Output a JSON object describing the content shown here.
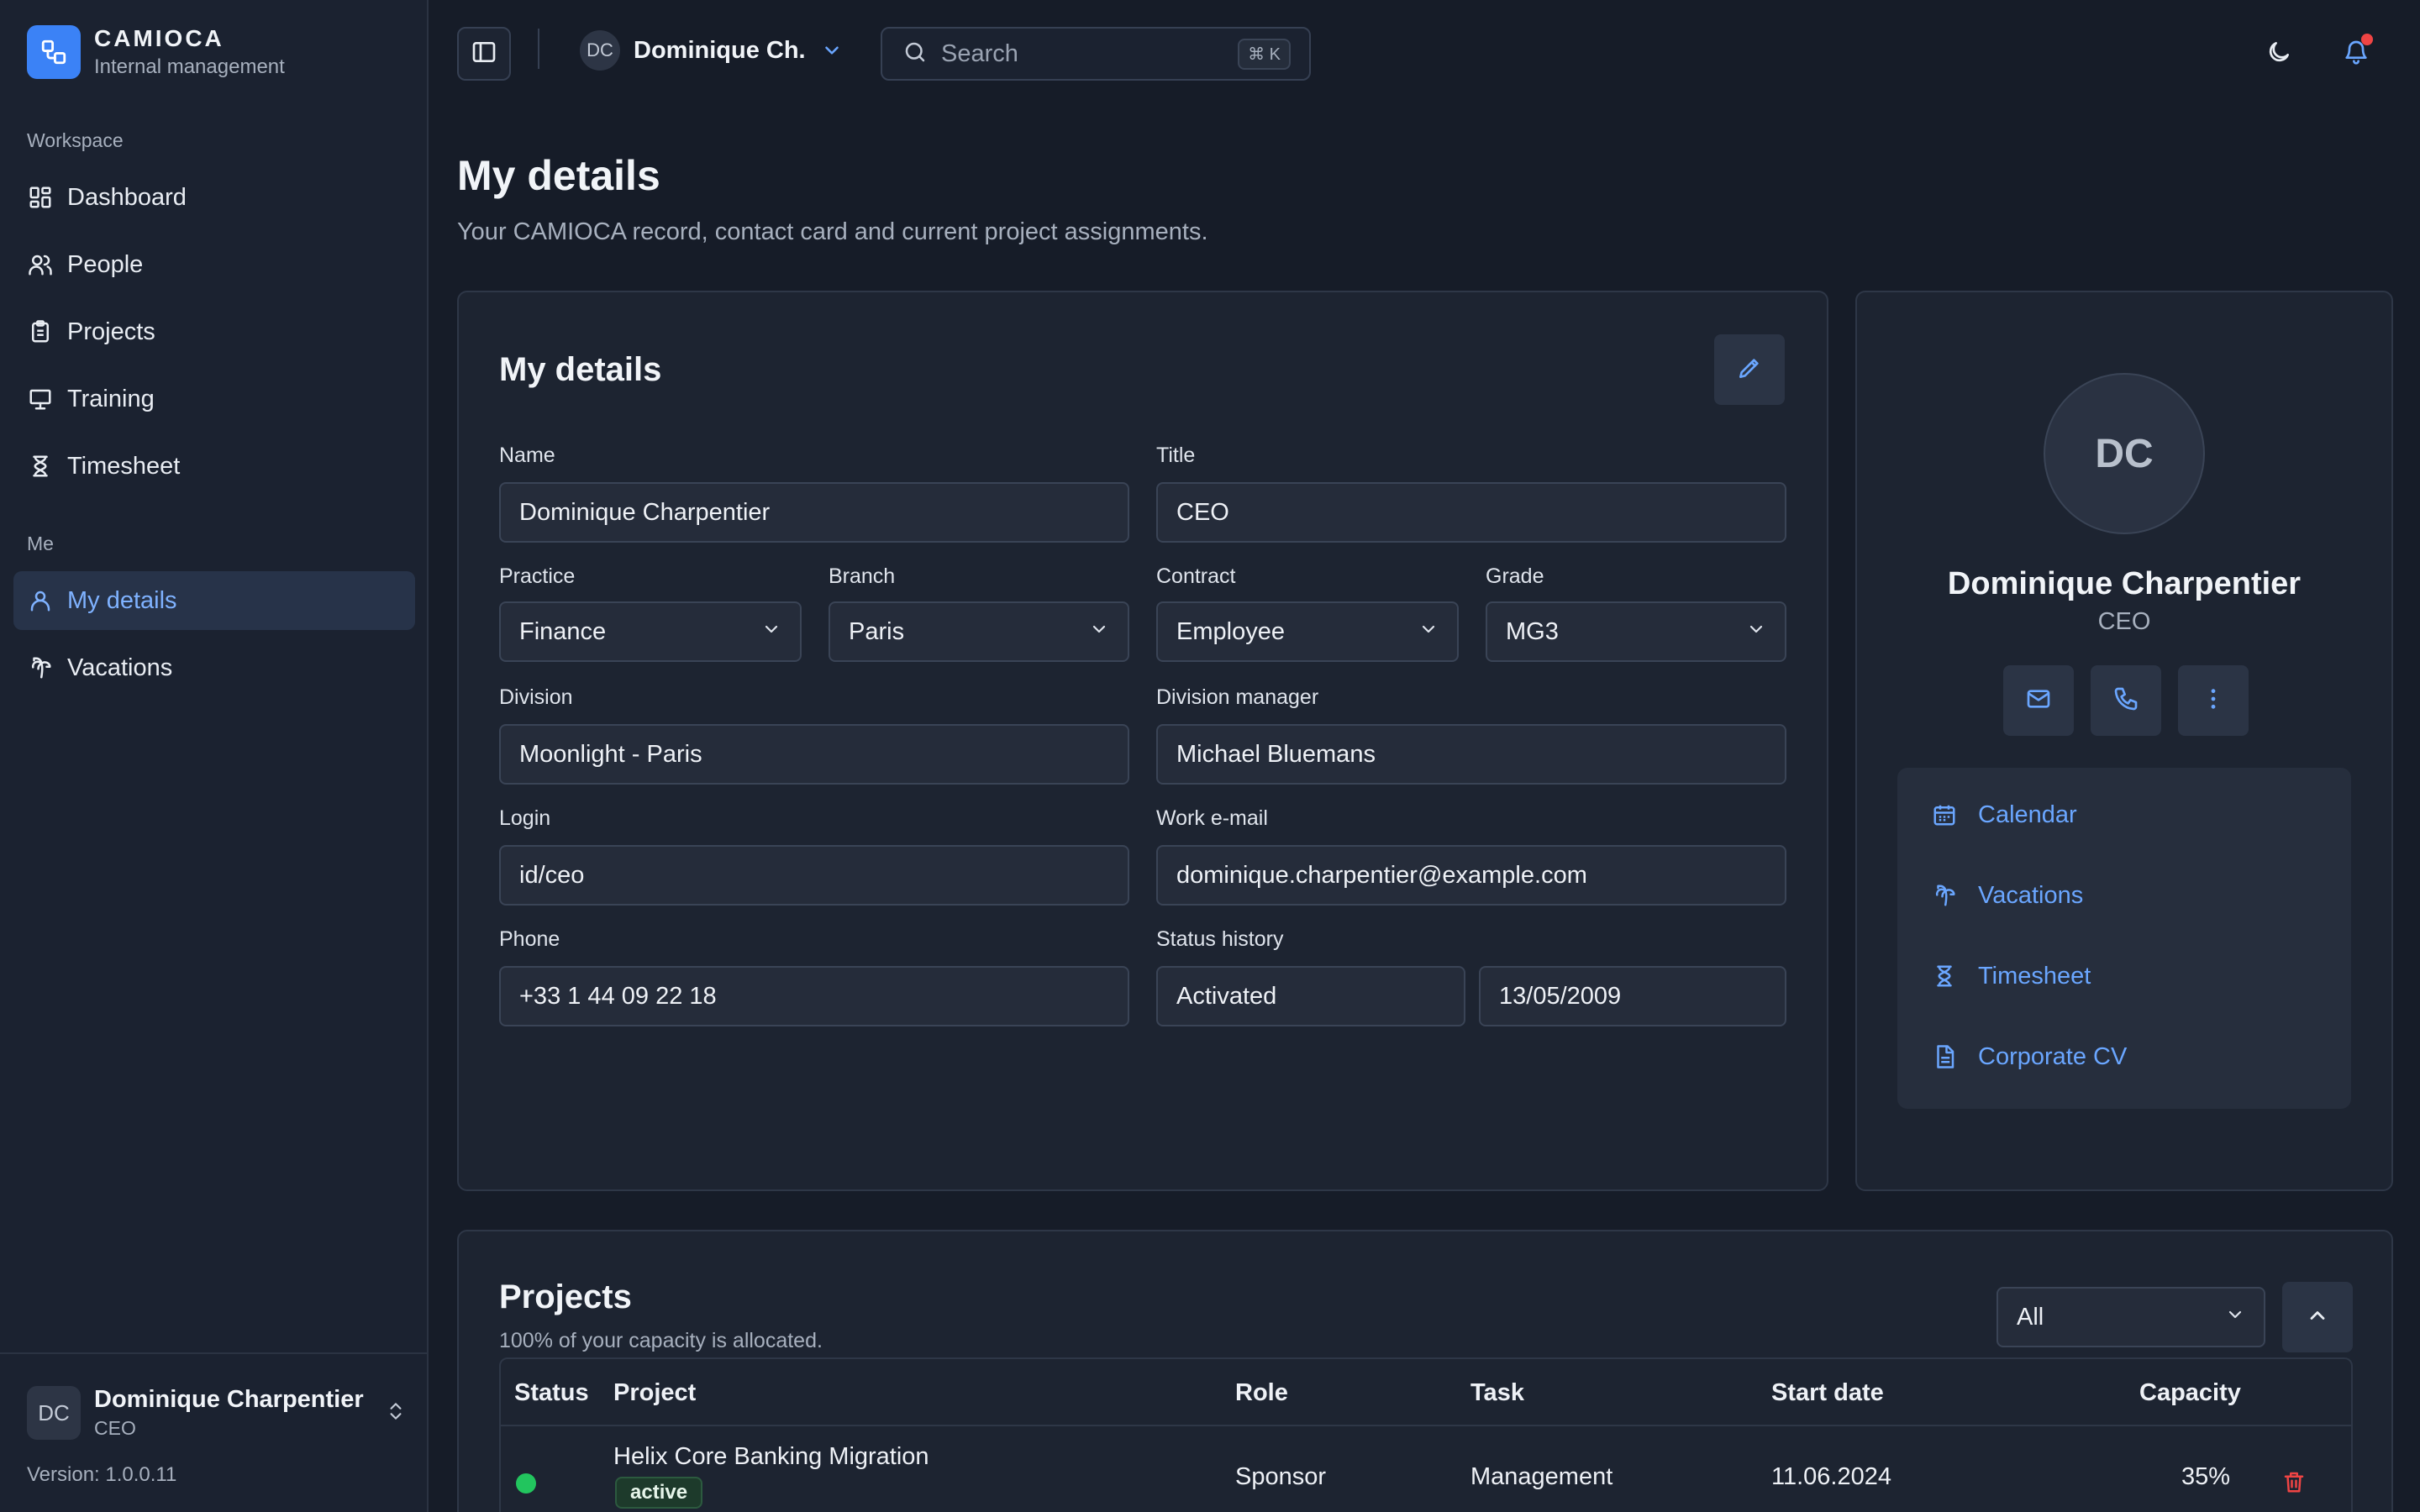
{
  "brand": {
    "name": "CAMIOCA",
    "subtitle": "Internal management"
  },
  "sidebar": {
    "sections": [
      {
        "label": "Workspace",
        "items": [
          {
            "label": "Dashboard",
            "icon": "dashboard-icon"
          },
          {
            "label": "People",
            "icon": "users-icon"
          },
          {
            "label": "Projects",
            "icon": "clipboard-icon"
          },
          {
            "label": "Training",
            "icon": "presentation-icon"
          },
          {
            "label": "Timesheet",
            "icon": "hourglass-icon"
          }
        ]
      },
      {
        "label": "Me",
        "items": [
          {
            "label": "My details",
            "icon": "user-icon",
            "active": true
          },
          {
            "label": "Vacations",
            "icon": "palm-tree-icon"
          }
        ]
      }
    ],
    "footer": {
      "avatar": "DC",
      "name": "Dominique Charpentier",
      "role": "CEO",
      "version": "Version: 1.0.0.11"
    }
  },
  "topbar": {
    "user_initials": "DC",
    "user_name": "Dominique Ch.",
    "search_placeholder": "Search",
    "search_shortcut": "⌘ K"
  },
  "page": {
    "title": "My details",
    "subtitle": "Your CAMIOCA record, contact card and current project assignments."
  },
  "details": {
    "title": "My details",
    "name": {
      "label": "Name",
      "value": "Dominique Charpentier"
    },
    "title_field": {
      "label": "Title",
      "value": "CEO"
    },
    "practice": {
      "label": "Practice",
      "value": "Finance"
    },
    "branch": {
      "label": "Branch",
      "value": "Paris"
    },
    "contract": {
      "label": "Contract",
      "value": "Employee"
    },
    "grade": {
      "label": "Grade",
      "value": "MG3"
    },
    "division": {
      "label": "Division",
      "value": "Moonlight - Paris"
    },
    "division_manager": {
      "label": "Division manager",
      "value": "Michael Bluemans"
    },
    "login": {
      "label": "Login",
      "value": "id/ceo"
    },
    "work_email": {
      "label": "Work e-mail",
      "value": "dominique.charpentier@example.com"
    },
    "phone": {
      "label": "Phone",
      "value": "+33 1 44 09 22 18"
    },
    "status_history": {
      "label": "Status history",
      "status": "Activated",
      "date": "13/05/2009"
    }
  },
  "profile": {
    "initials": "DC",
    "name": "Dominique Charpentier",
    "role": "CEO",
    "links": [
      {
        "label": "Calendar",
        "icon": "calendar-icon"
      },
      {
        "label": "Vacations",
        "icon": "palm-tree-icon"
      },
      {
        "label": "Timesheet",
        "icon": "hourglass-icon"
      },
      {
        "label": "Corporate CV",
        "icon": "document-icon"
      }
    ]
  },
  "projects": {
    "title": "Projects",
    "subtitle": "100% of your capacity is allocated.",
    "filter": "All",
    "columns": [
      "Status",
      "Project",
      "Role",
      "Task",
      "Start date",
      "Capacity"
    ],
    "rows": [
      {
        "status": "active",
        "project": "Helix Core Banking Migration",
        "badge": "active",
        "role": "Sponsor",
        "task": "Management",
        "start_date": "11.06.2024",
        "capacity": "35%"
      }
    ]
  },
  "colors": {
    "accent": "#3b82f6",
    "link": "#6aa6ff",
    "active_status": "#22c55e",
    "danger": "#ef4444"
  }
}
